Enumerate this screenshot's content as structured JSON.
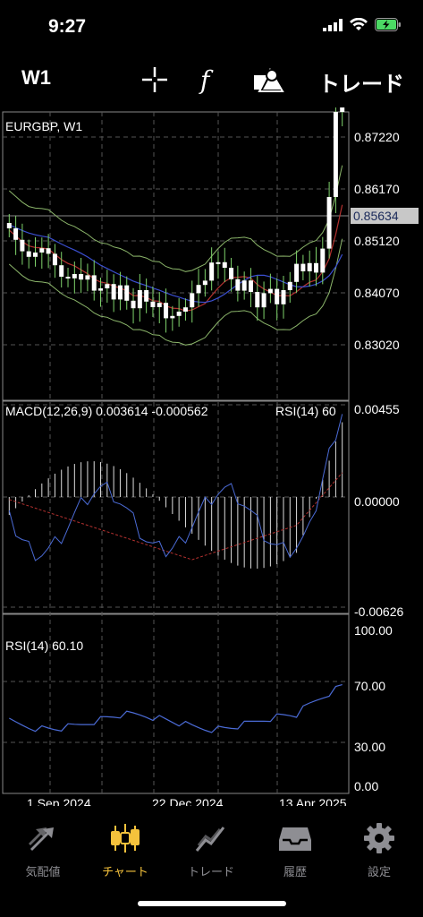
{
  "status": {
    "time": "9:27"
  },
  "toolbar": {
    "timeframe": "W1",
    "trade_label": "トレード"
  },
  "chart": {
    "symbol_label": "EURGBP, W1",
    "macd_label": "MACD(12,26,9) 0.003614 -0.000562",
    "rsi_overlay_label": "RSI(14) 60",
    "rsi_label": "RSI(14) 60.10",
    "current_price": "0.85634",
    "price_ticks": [
      "0.87220",
      "0.86170",
      "0.85120",
      "0.84070",
      "0.83020"
    ],
    "macd_ticks": [
      "0.00455",
      "0.00000",
      "-0.00626"
    ],
    "rsi_ticks": [
      "100.00",
      "70.00",
      "30.00",
      "0.00"
    ],
    "date_ticks": [
      "1 Sep 2024",
      "22 Dec 2024",
      "13 Apr 2025"
    ],
    "colors": {
      "bull": "#ffffff",
      "bear": "#ffffff",
      "wick": "#7fd36b",
      "bands": "#8bb56a",
      "ma_red": "#b3312f",
      "ma_blue": "#3b4fd0",
      "rsi_line": "#4b6bd6",
      "grid": "#555555"
    }
  },
  "tabs": [
    {
      "label": "気配値",
      "icon": "quotes-arrows-icon",
      "active": false
    },
    {
      "label": "チャート",
      "icon": "candlestick-icon",
      "active": true
    },
    {
      "label": "トレード",
      "icon": "trade-chart-icon",
      "active": false
    },
    {
      "label": "履歴",
      "icon": "inbox-tray-icon",
      "active": false
    },
    {
      "label": "設定",
      "icon": "gear-icon",
      "active": false
    }
  ]
}
